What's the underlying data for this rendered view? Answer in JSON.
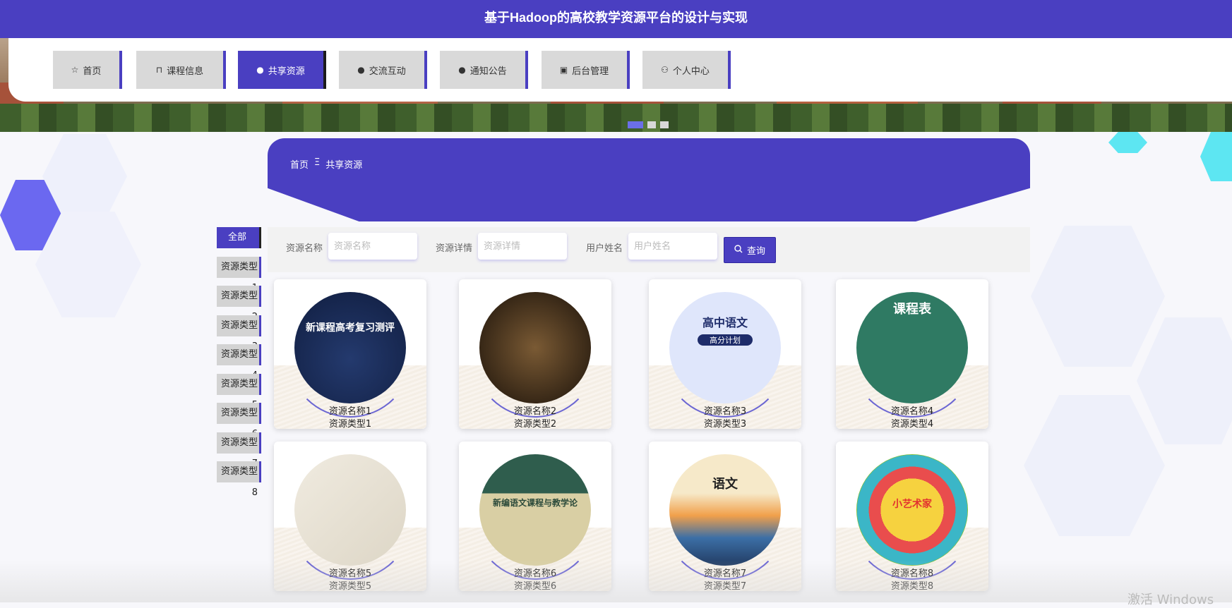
{
  "header": {
    "title": "基于Hadoop的高校教学资源平台的设计与实现"
  },
  "nav": {
    "items": [
      {
        "label": "首页",
        "icon": "star-icon",
        "glyph": "☆",
        "active": false
      },
      {
        "label": "课程信息",
        "icon": "bag-icon",
        "glyph": "⊓",
        "active": false
      },
      {
        "label": "共享资源",
        "icon": "info-icon",
        "glyph": "●",
        "active": true
      },
      {
        "label": "交流互动",
        "icon": "question-icon",
        "glyph": "●",
        "active": false
      },
      {
        "label": "通知公告",
        "icon": "info-icon",
        "glyph": "●",
        "active": false
      },
      {
        "label": "后台管理",
        "icon": "briefcase-icon",
        "glyph": "▣",
        "active": false
      },
      {
        "label": "个人中心",
        "icon": "user-icon",
        "glyph": "⚇",
        "active": false
      }
    ]
  },
  "carousel": {
    "count": 3,
    "active_index": 0
  },
  "breadcrumb": {
    "home": "首页",
    "separator": "Ξ",
    "current": "共享资源"
  },
  "categories": {
    "items": [
      "全部",
      "资源类型1",
      "资源类型2",
      "资源类型3",
      "资源类型4",
      "资源类型5",
      "资源类型6",
      "资源类型7",
      "资源类型8"
    ],
    "active_index": 0
  },
  "search": {
    "fields": [
      {
        "label": "资源名称",
        "placeholder": "资源名称",
        "value": ""
      },
      {
        "label": "资源详情",
        "placeholder": "资源详情",
        "value": ""
      },
      {
        "label": "用户姓名",
        "placeholder": "用户姓名",
        "value": ""
      }
    ],
    "button_label": "查询",
    "button_icon": "search-icon"
  },
  "resources": [
    {
      "name": "资源名称1",
      "type": "资源类型1"
    },
    {
      "name": "资源名称2",
      "type": "资源类型2"
    },
    {
      "name": "资源名称3",
      "type": "资源类型3"
    },
    {
      "name": "资源名称4",
      "type": "资源类型4"
    },
    {
      "name": "资源名称5",
      "type": "资源类型5"
    },
    {
      "name": "资源名称6",
      "type": "资源类型6"
    },
    {
      "name": "资源名称7",
      "type": "资源类型7"
    },
    {
      "name": "资源名称8",
      "type": "资源类型8"
    }
  ],
  "image_texts": {
    "cover1": "新课程高考复习测评",
    "cover3_title": "高中语文",
    "cover3_sub": "高分计划",
    "cover4": "课程表",
    "cover6_title": "新编语文课程与教学论",
    "cover7": "语文",
    "cover8": "小艺术家"
  },
  "watermark": "激活 Windows",
  "colors": {
    "primary": "#4a3fc1",
    "nav_inactive": "#d9d9d9"
  }
}
